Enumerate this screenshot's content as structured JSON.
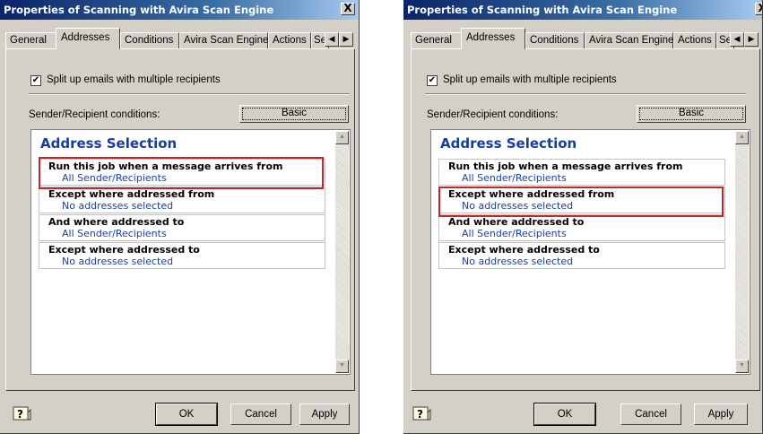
{
  "dialogs": [
    {
      "title": "Properties of Scanning with Avira Scan Engine",
      "close_label": "X",
      "tabs": [
        "General",
        "Addresses",
        "Conditions",
        "Avira Scan Engine",
        "Actions",
        "Servi"
      ],
      "active_tab": "Addresses",
      "split_checkbox": {
        "label": "Split up emails with multiple recipients",
        "checked": true,
        "mark": "✔"
      },
      "conditions_label": "Sender/Recipient conditions:",
      "basic_button": "Basic",
      "address_selection_title": "Address Selection",
      "items": [
        {
          "title": "Run this job when a message arrives from",
          "value": "All Sender/Recipients"
        },
        {
          "title": "Except where addressed from",
          "value": "No addresses selected"
        },
        {
          "title": "And where addressed to",
          "value": "All Sender/Recipients"
        },
        {
          "title": "Except where addressed to",
          "value": "No addresses selected"
        }
      ],
      "highlighted_item": 0,
      "buttons": {
        "ok": "OK",
        "cancel": "Cancel",
        "apply": "Apply"
      }
    },
    {
      "title": "Properties of Scanning with Avira Scan Engine",
      "close_label": "X",
      "tabs": [
        "General",
        "Addresses",
        "Conditions",
        "Avira Scan Engine",
        "Actions",
        "Servi"
      ],
      "active_tab": "Addresses",
      "split_checkbox": {
        "label": "Split up emails with multiple recipients",
        "checked": true,
        "mark": "✔"
      },
      "conditions_label": "Sender/Recipient conditions:",
      "basic_button": "Basic",
      "address_selection_title": "Address Selection",
      "items": [
        {
          "title": "Run this job when a message arrives from",
          "value": "All Sender/Recipients"
        },
        {
          "title": "Except where addressed from",
          "value": "No addresses selected"
        },
        {
          "title": "And where addressed to",
          "value": "All Sender/Recipients"
        },
        {
          "title": "Except where addressed to",
          "value": "No addresses selected"
        }
      ],
      "highlighted_item": 1,
      "buttons": {
        "ok": "OK",
        "cancel": "Cancel",
        "apply": "Apply"
      }
    }
  ],
  "colors": {
    "highlight": "#c0282c",
    "title_bar": "#0a246a",
    "address_title": "#153e9f",
    "link": "#1a3fa0"
  },
  "icons": {
    "help": "help-icon",
    "close": "close-icon",
    "scroll_left": "arrow-left-icon",
    "scroll_right": "arrow-right-icon",
    "scroll_up": "arrow-up-icon",
    "scroll_down": "arrow-down-icon"
  }
}
